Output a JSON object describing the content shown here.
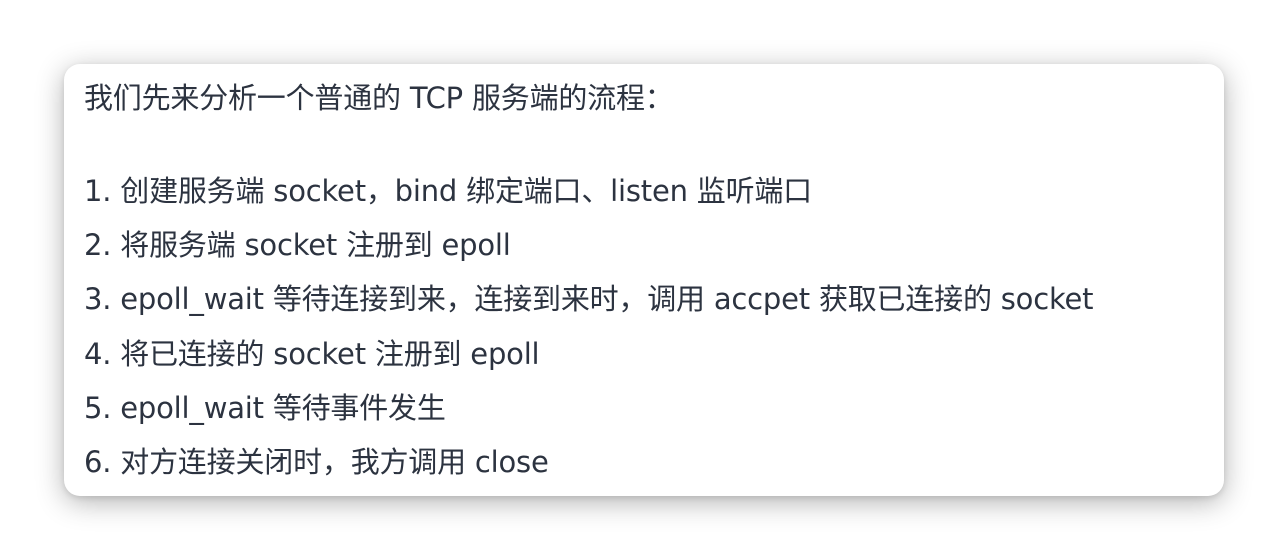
{
  "intro": "我们先来分析一个普通的 TCP 服务端的流程：",
  "steps": [
    "1. 创建服务端 socket，bind 绑定端口、listen 监听端口",
    "2. 将服务端 socket 注册到 epoll",
    "3. epoll_wait 等待连接到来，连接到来时，调用 accpet 获取已连接的 socket",
    "4. 将已连接的 socket 注册到 epoll",
    "5. epoll_wait 等待事件发生",
    "6. 对方连接关闭时，我方调用 close"
  ]
}
